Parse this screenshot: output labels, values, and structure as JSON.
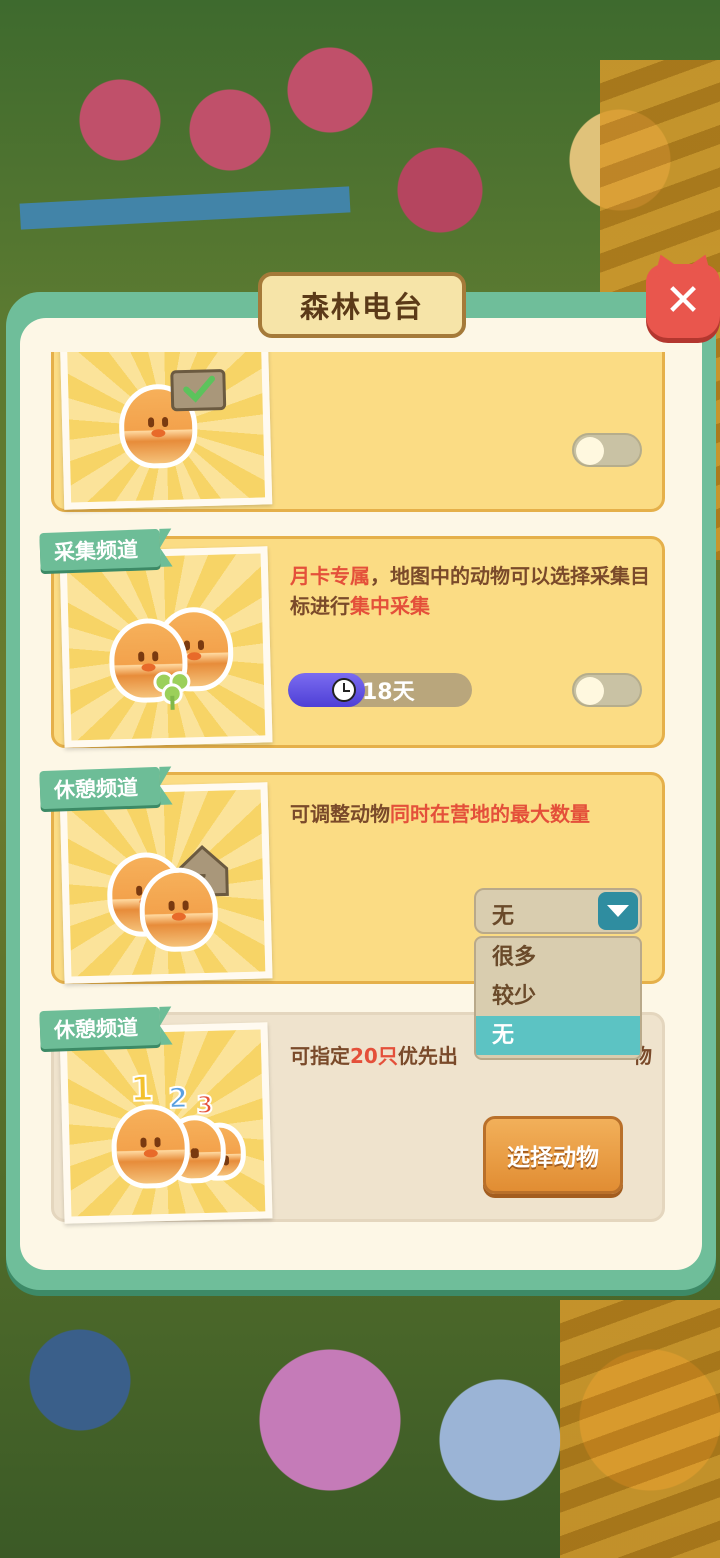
{
  "dialog": {
    "title": "森林电台",
    "close_symbol": "✕"
  },
  "channels": [
    {
      "ribbon": "",
      "description": [],
      "toggle_on": false
    },
    {
      "ribbon": "采集频道",
      "description": [
        {
          "text": "月卡专属",
          "highlight": true
        },
        {
          "text": "，地图中的动物可以选择采集目标进行",
          "highlight": false
        },
        {
          "text": "集中采集",
          "highlight": true
        }
      ],
      "timer_label": "18天",
      "timer_progress": 0.42,
      "toggle_on": false
    },
    {
      "ribbon": "休憩频道",
      "description": [
        {
          "text": "可调整动物",
          "highlight": false
        },
        {
          "text": "同时在营地的最大数量",
          "highlight": true
        }
      ],
      "select_value": "无",
      "options": [
        "很多",
        "较少",
        "无"
      ],
      "selected_option": "无"
    },
    {
      "ribbon": "休憩频道",
      "description": [
        {
          "text": "可指定",
          "highlight": false
        },
        {
          "text": "20只",
          "highlight": true
        },
        {
          "text": "优先出",
          "highlight": false
        }
      ],
      "description_tail": "物",
      "button_label": "选择动物"
    }
  ],
  "icons": {
    "card1": "check-sign-icon",
    "card2": "clover-icon",
    "card3": "house-z-icon",
    "card4": "number-ranking-icon"
  },
  "colors": {
    "highlight": "#e4503a",
    "frame": "#6fbe9a",
    "card": "#fbdc84",
    "timer_fill": "#4e3fd6",
    "selected_option": "#5cc3c3",
    "button": "#e18d33",
    "close": "#e9564d"
  }
}
